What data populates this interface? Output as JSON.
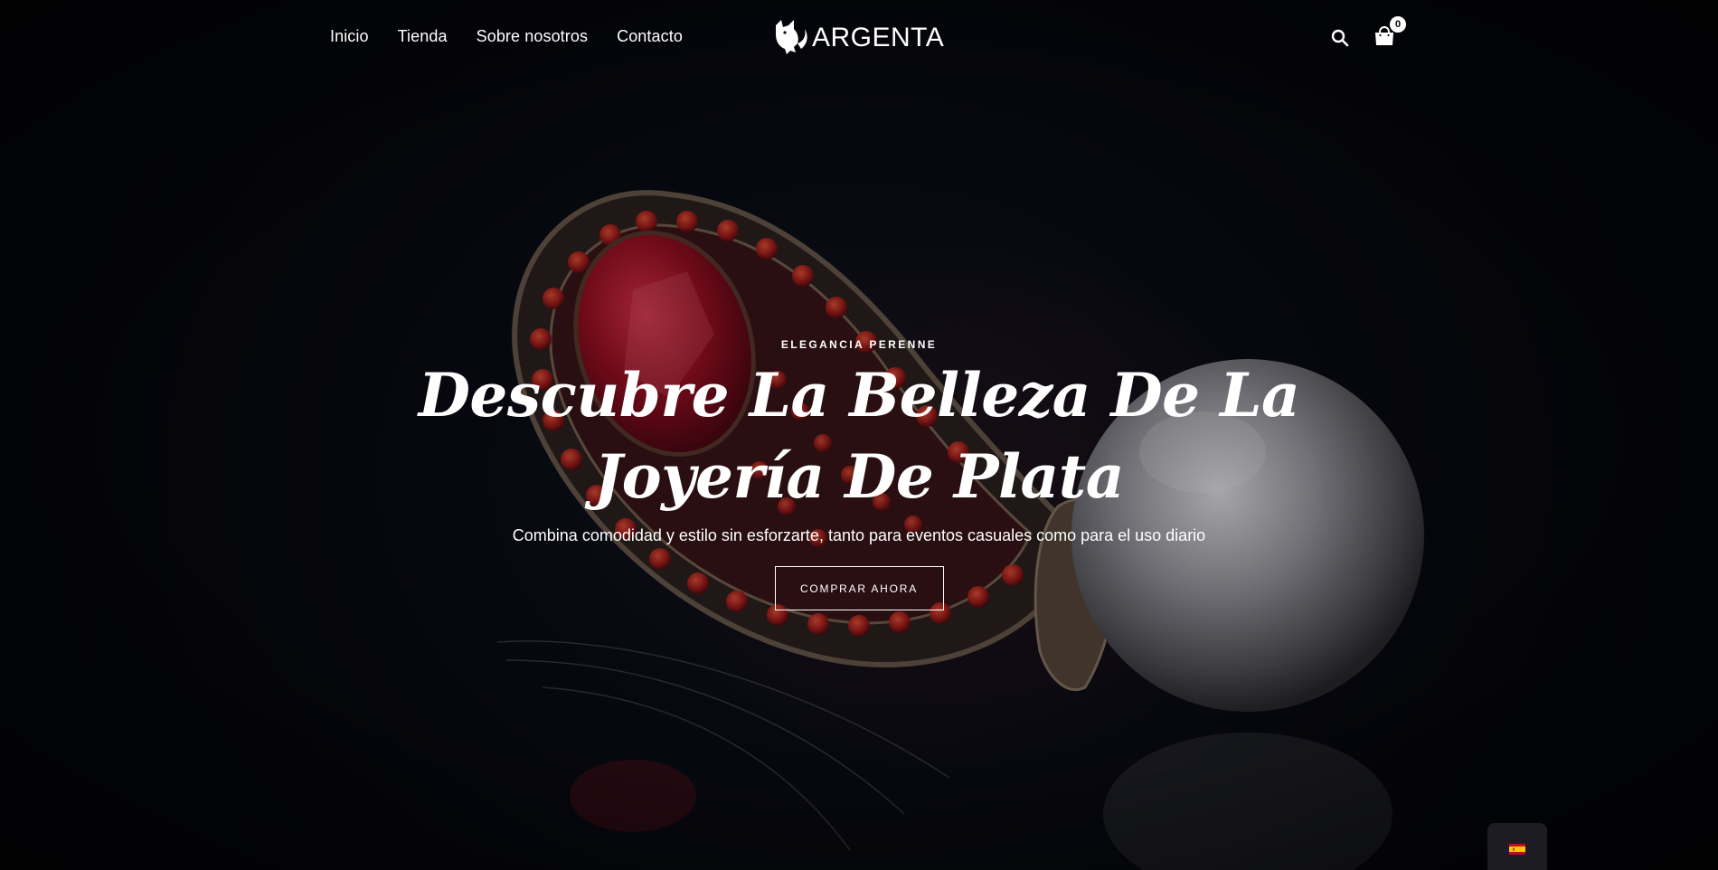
{
  "nav": {
    "items": [
      {
        "label": "Inicio"
      },
      {
        "label": "Tienda"
      },
      {
        "label": "Sobre nosotros"
      },
      {
        "label": "Contacto"
      }
    ]
  },
  "brand": {
    "name": "ARGENTA",
    "logo_icon": "fox-logo-icon"
  },
  "header_actions": {
    "search_icon": "search-icon",
    "cart_icon": "shopping-bag-icon",
    "cart_count": "0"
  },
  "hero": {
    "eyebrow": "ELEGANCIA PERENNE",
    "title_line1": "Descubre La Belleza De La",
    "title_line2": "Joyería De Plata",
    "subtitle": "Combina comodidad y estilo sin esforzarte, tanto para eventos casuales como para el uso diario",
    "cta_label": "COMPRAR AHORA"
  },
  "language": {
    "flag_icon": "spain-flag-icon"
  },
  "colors": {
    "background": "#07080f",
    "text": "#ffffff",
    "gem_red": "#b3122a",
    "pearl": "#d9d9dc"
  }
}
